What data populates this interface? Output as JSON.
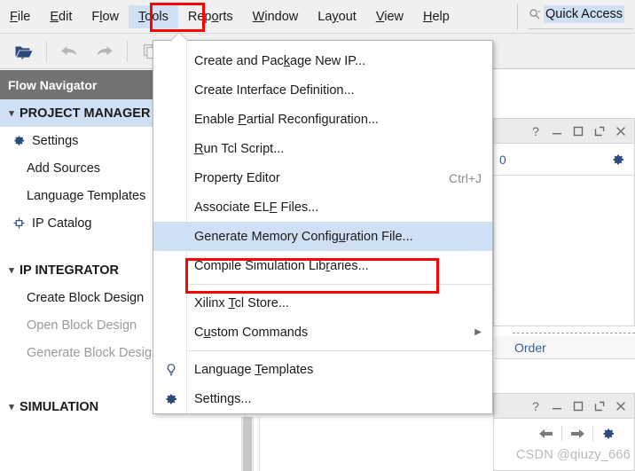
{
  "menubar": {
    "items": [
      {
        "label": "File",
        "mnemonic_index": 0,
        "active": false
      },
      {
        "label": "Edit",
        "mnemonic_index": 0,
        "active": false
      },
      {
        "label": "Flow",
        "mnemonic_index": 1,
        "active": false
      },
      {
        "label": "Tools",
        "mnemonic_index": 0,
        "active": true
      },
      {
        "label": "Reports",
        "mnemonic_index": 3,
        "active": false
      },
      {
        "label": "Window",
        "mnemonic_index": 0,
        "active": false
      },
      {
        "label": "Layout",
        "mnemonic_index": 2,
        "active": false
      },
      {
        "label": "View",
        "mnemonic_index": 0,
        "active": false
      },
      {
        "label": "Help",
        "mnemonic_index": 0,
        "active": false
      }
    ],
    "quick_access": {
      "text": "Quick Access",
      "icon": "search-icon",
      "selected": true
    }
  },
  "toolbar": {
    "buttons": [
      {
        "name": "open-project-icon",
        "enabled": true
      },
      {
        "name": "undo-icon",
        "enabled": false
      },
      {
        "name": "redo-icon",
        "enabled": false
      },
      {
        "name": "copy-icon",
        "enabled": false
      }
    ]
  },
  "flow_navigator": {
    "title": "Flow Navigator",
    "sections": [
      {
        "label": "PROJECT MANAGER",
        "expanded": true,
        "selected": true,
        "items": [
          {
            "label": "Settings",
            "icon": "gear-icon",
            "disabled": false
          },
          {
            "label": "Add Sources",
            "icon": null,
            "disabled": false
          },
          {
            "label": "Language Templates",
            "icon": null,
            "disabled": false
          },
          {
            "label": "IP Catalog",
            "icon": "ip-catalog-icon",
            "disabled": false
          }
        ]
      },
      {
        "label": "IP INTEGRATOR",
        "expanded": true,
        "selected": false,
        "items": [
          {
            "label": "Create Block Design",
            "icon": null,
            "disabled": false
          },
          {
            "label": "Open Block Design",
            "icon": null,
            "disabled": true
          },
          {
            "label": "Generate Block Design",
            "icon": null,
            "disabled": true
          }
        ]
      },
      {
        "label": "SIMULATION",
        "expanded": true,
        "selected": false,
        "items": []
      }
    ]
  },
  "tools_menu": {
    "groups": [
      {
        "items": [
          {
            "label": "Create and Package New IP...",
            "mnemonic": "k",
            "shortcut": "",
            "icon": null,
            "submenu": false,
            "highlighted": false
          },
          {
            "label": "Create Interface Definition...",
            "mnemonic": "",
            "shortcut": "",
            "icon": null,
            "submenu": false,
            "highlighted": false
          },
          {
            "label": "Enable Partial Reconfiguration...",
            "mnemonic": "P",
            "shortcut": "",
            "icon": null,
            "submenu": false,
            "highlighted": false
          },
          {
            "label": "Run Tcl Script...",
            "mnemonic": "R",
            "shortcut": "",
            "icon": null,
            "submenu": false,
            "highlighted": false
          },
          {
            "label": "Property Editor",
            "mnemonic": "",
            "shortcut": "Ctrl+J",
            "icon": null,
            "submenu": false,
            "highlighted": false
          },
          {
            "label": "Associate ELF Files...",
            "mnemonic": "F",
            "shortcut": "",
            "icon": null,
            "submenu": false,
            "highlighted": false
          },
          {
            "label": "Generate Memory Configuration File...",
            "mnemonic": "u",
            "shortcut": "",
            "icon": null,
            "submenu": false,
            "highlighted": true
          },
          {
            "label": "Compile Simulation Libraries...",
            "mnemonic": "r",
            "shortcut": "",
            "icon": null,
            "submenu": false,
            "highlighted": false
          }
        ]
      },
      {
        "items": [
          {
            "label": "Xilinx Tcl Store...",
            "mnemonic": "T",
            "shortcut": "",
            "icon": null,
            "submenu": false,
            "highlighted": false
          },
          {
            "label": "Custom Commands",
            "mnemonic": "u",
            "shortcut": "",
            "icon": null,
            "submenu": true,
            "highlighted": false
          }
        ]
      },
      {
        "items": [
          {
            "label": "Language Templates",
            "mnemonic": "T",
            "shortcut": "",
            "icon": "lightbulb-icon",
            "submenu": false,
            "highlighted": false
          },
          {
            "label": "Settings...",
            "mnemonic": "",
            "shortcut": "",
            "icon": "gear-icon",
            "submenu": false,
            "highlighted": false
          }
        ]
      }
    ]
  },
  "right_panels": {
    "top_panel": {
      "titlebar_icons": [
        "help-icon",
        "minimize-icon",
        "maximize-icon",
        "float-icon",
        "close-icon"
      ],
      "count_text": "0",
      "settings_icon": "gear-icon"
    },
    "order_bar": {
      "label": "Order"
    },
    "bottom_panel": {
      "titlebar_icons": [
        "help-icon",
        "minimize-icon",
        "maximize-icon",
        "float-icon",
        "close-icon"
      ],
      "nav_icons": [
        "back-arrow-icon",
        "forward-arrow-icon",
        "gear-icon"
      ]
    }
  },
  "annotations": {
    "tools_highlight_color": "#ff0000",
    "menu_item_highlight_color": "#ff0000",
    "selection_color": "#cfe0f5"
  },
  "watermark": {
    "text": "CSDN @qiuzy_666"
  }
}
